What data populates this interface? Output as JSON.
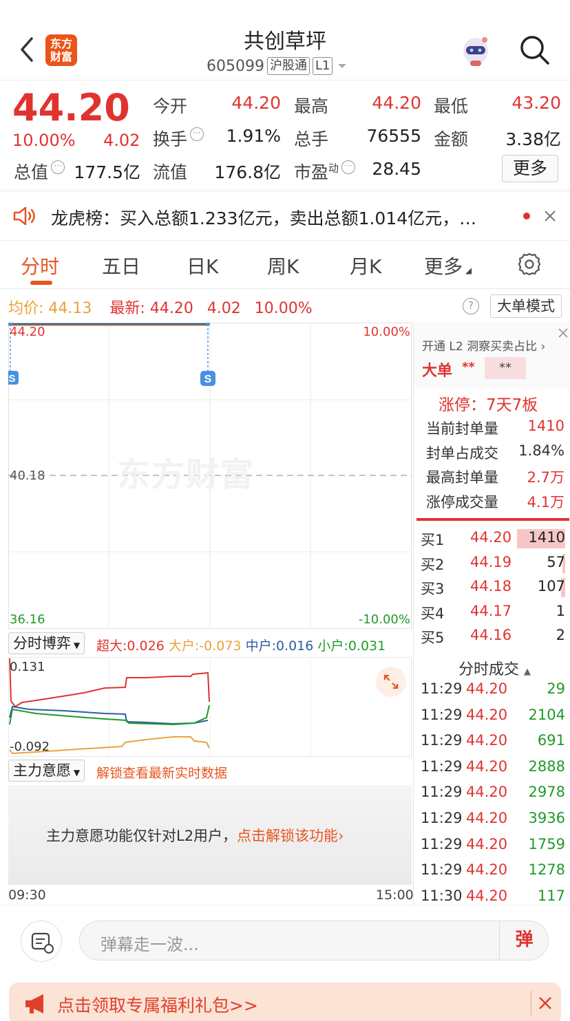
{
  "header": {
    "title": "共创草坪",
    "code": "605099",
    "tag_connect": "沪股通",
    "tag_level": "L1",
    "logo_text_line1": "东方",
    "logo_text_line2": "财富"
  },
  "quote": {
    "price": "44.20",
    "change_pct": "10.00%",
    "change": "4.02",
    "open_label": "今开",
    "open": "44.20",
    "high_label": "最高",
    "high": "44.20",
    "low_label": "最低",
    "low": "43.20",
    "turnover_label": "换手",
    "turnover": "1.91%",
    "volume_label": "总手",
    "volume": "76555",
    "amount_label": "金额",
    "amount": "3.38亿",
    "mktcap_label": "总值",
    "mktcap": "177.5亿",
    "float_label": "流值",
    "float_cap": "176.8亿",
    "pe_label": "市盈",
    "pe_sup": "动",
    "pe": "28.45",
    "more_label": "更多"
  },
  "dragon_tiger": {
    "text": "龙虎榜：买入总额1.233亿元，卖出总额1.014亿元，…"
  },
  "tabs": [
    "分时",
    "五日",
    "日K",
    "周K",
    "月K",
    "更多"
  ],
  "avg_row": {
    "avg_label": "均价:",
    "avg_value": "44.13",
    "latest_label": "最新:",
    "latest_value": "44.20",
    "latest_change": "4.02",
    "latest_pct": "10.00%",
    "help": "?",
    "big_order_mode": "大单模式"
  },
  "chart": {
    "y_top": "44.20",
    "y_mid": "40.18",
    "y_bottom": "36.16",
    "pct_top": "10.00%",
    "pct_bottom": "-10.00%",
    "marker": "S",
    "watermark": "东方财富",
    "time_start": "09:30",
    "time_end": "15:00"
  },
  "chart_data": {
    "type": "line",
    "title": "",
    "ylim": [
      36.16,
      44.2
    ],
    "x_range": [
      "09:30",
      "15:00"
    ],
    "series": [
      {
        "values": [
          44.2,
          44.2
        ]
      },
      {
        "values": [
          44.13,
          44.13
        ]
      }
    ]
  },
  "game": {
    "dropdown": "分时博弈",
    "super_label": "超大:",
    "super_value": "0.026",
    "big_label": "大户:",
    "big_value": "-0.073",
    "mid_label": "中户:",
    "mid_value": "0.016",
    "small_label": "小户:",
    "small_value": "0.031",
    "y_top": "0.131",
    "y_bottom": "-0.092"
  },
  "intent": {
    "dropdown": "主力意愿",
    "unlock_hint": "解锁查看最新实时数据",
    "locked_text": "主力意愿功能仅针对L2用户，",
    "locked_link": "点击解锁该功能"
  },
  "right_panel": {
    "l2_promo": "开通 L2 洞察买卖占比",
    "big_order_label": "大单",
    "big_order_v1": "**",
    "big_order_v2": "**",
    "limit_label": "涨停：7天7板",
    "stats": [
      {
        "label": "当前封单量",
        "value": "1410"
      },
      {
        "label": "封单占成交",
        "value": "1.84%"
      },
      {
        "label": "最高封单量",
        "value": "2.7万"
      },
      {
        "label": "涨停成交量",
        "value": "4.1万"
      }
    ],
    "bids": [
      {
        "label": "买1",
        "price": "44.20",
        "vol": "1410",
        "fill": 0.35
      },
      {
        "label": "买2",
        "price": "44.19",
        "vol": "57",
        "fill": 0.02
      },
      {
        "label": "买3",
        "price": "44.18",
        "vol": "107",
        "fill": 0.03
      },
      {
        "label": "买4",
        "price": "44.17",
        "vol": "1",
        "fill": 0
      },
      {
        "label": "买5",
        "price": "44.16",
        "vol": "2",
        "fill": 0
      }
    ],
    "trades_title": "分时成交",
    "trades": [
      {
        "time": "11:29",
        "price": "44.20",
        "vol": "29"
      },
      {
        "time": "11:29",
        "price": "44.20",
        "vol": "2104"
      },
      {
        "time": "11:29",
        "price": "44.20",
        "vol": "691"
      },
      {
        "time": "11:29",
        "price": "44.20",
        "vol": "2888"
      },
      {
        "time": "11:29",
        "price": "44.20",
        "vol": "2978"
      },
      {
        "time": "11:29",
        "price": "44.20",
        "vol": "3936"
      },
      {
        "time": "11:29",
        "price": "44.20",
        "vol": "1759"
      },
      {
        "time": "11:29",
        "price": "44.20",
        "vol": "1278"
      },
      {
        "time": "11:30",
        "price": "44.20",
        "vol": "117"
      }
    ]
  },
  "bottom": {
    "danmu_placeholder": "弹幕走一波...",
    "danmu_send": "弹",
    "promo": "点击领取专属福利礼包>>"
  },
  "colors": {
    "up": "#e0332f",
    "down": "#1f9a2a",
    "accent": "#e8541e",
    "avg_line": "#e8a23a"
  }
}
